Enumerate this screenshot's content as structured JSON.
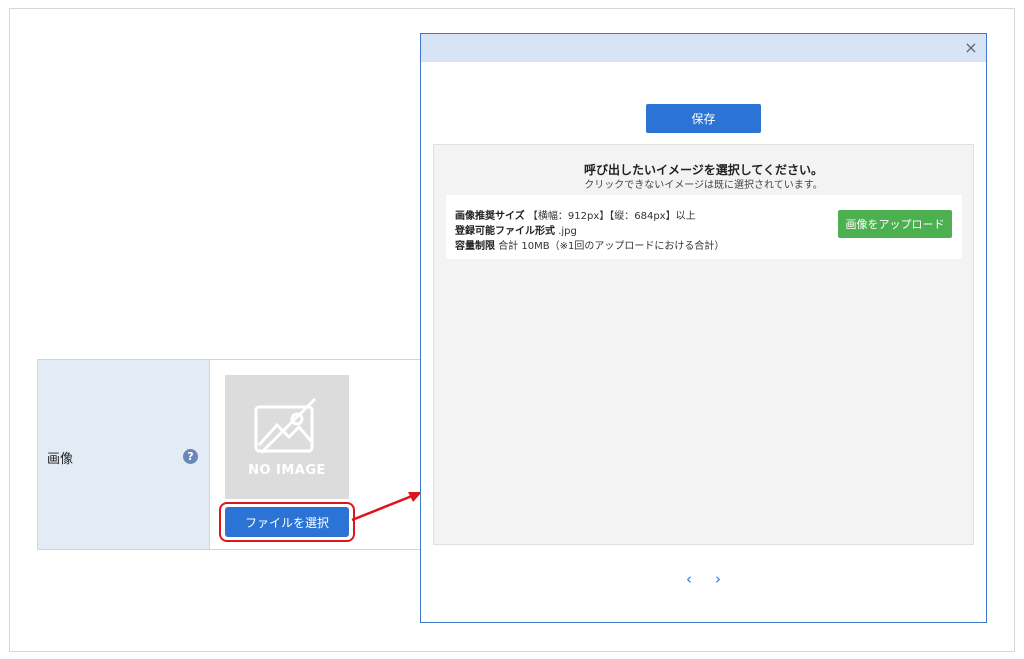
{
  "form": {
    "label": "画像",
    "help_icon": "?",
    "no_image_text": "NO IMAGE",
    "file_button": "ファイルを選択"
  },
  "modal": {
    "close": "×",
    "save_button": "保存",
    "gallery": {
      "title": "呼び出したいイメージを選択してください。",
      "subtitle": "クリックできないイメージは既に選択されています。"
    },
    "upload": {
      "size_label": "画像推奨サイズ",
      "size_value": "【横幅：912px】【縦：684px】以上",
      "format_label": "登録可能ファイル形式",
      "format_value": ".jpg",
      "limit_label": "容量制限",
      "limit_value": "合計 10MB（※1回のアップロードにおける合計）",
      "button": "画像をアップロード"
    },
    "pager": {
      "prev": "‹",
      "next": "›"
    }
  },
  "colors": {
    "primary": "#2b74d6",
    "upload_green": "#4caf50",
    "highlight_red": "#e0141b",
    "header_blue": "#d7e4f5",
    "label_cell": "#e3ebf5"
  },
  "icons": [
    "help-icon",
    "image-placeholder-icon",
    "close-icon",
    "chevron-left-icon",
    "chevron-right-icon",
    "arrow-annotation-icon"
  ]
}
